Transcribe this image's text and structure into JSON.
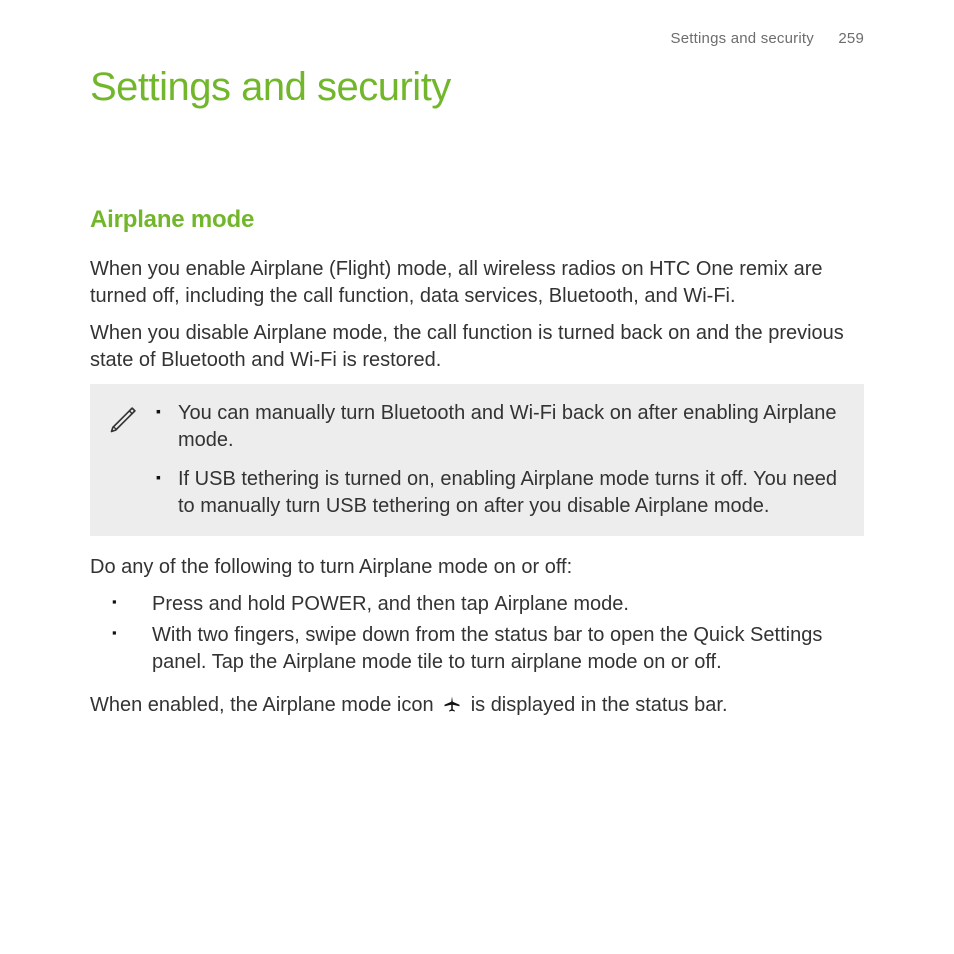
{
  "header": {
    "chapter": "Settings and security",
    "page_number": "259"
  },
  "title": "Settings and security",
  "section": {
    "heading": "Airplane mode",
    "para1": "When you enable Airplane (Flight) mode, all wireless radios on HTC One remix are turned off, including the call function, data services, Bluetooth, and Wi-Fi.",
    "para2": "When you disable Airplane mode, the call function is turned back on and the previous state of Bluetooth and Wi-Fi is restored.",
    "note_items": [
      "You can manually turn Bluetooth and Wi-Fi back on after enabling Airplane mode.",
      "If USB tethering is turned on, enabling Airplane mode turns it off. You need to manually turn USB tethering on after you disable Airplane mode."
    ],
    "para3": "Do any of the following to turn Airplane mode on or off:",
    "steps": {
      "item1_pre": "Press and hold POWER, and then tap ",
      "item1_bold": "Airplane mode",
      "item1_post": ".",
      "item2_pre": "With two fingers, swipe down from the status bar to open the Quick Settings panel. Tap the ",
      "item2_bold": "Airplane mode",
      "item2_post": " tile to turn airplane mode on or off."
    },
    "para4_pre": "When enabled, the Airplane mode icon ",
    "para4_post": " is displayed in the status bar."
  }
}
